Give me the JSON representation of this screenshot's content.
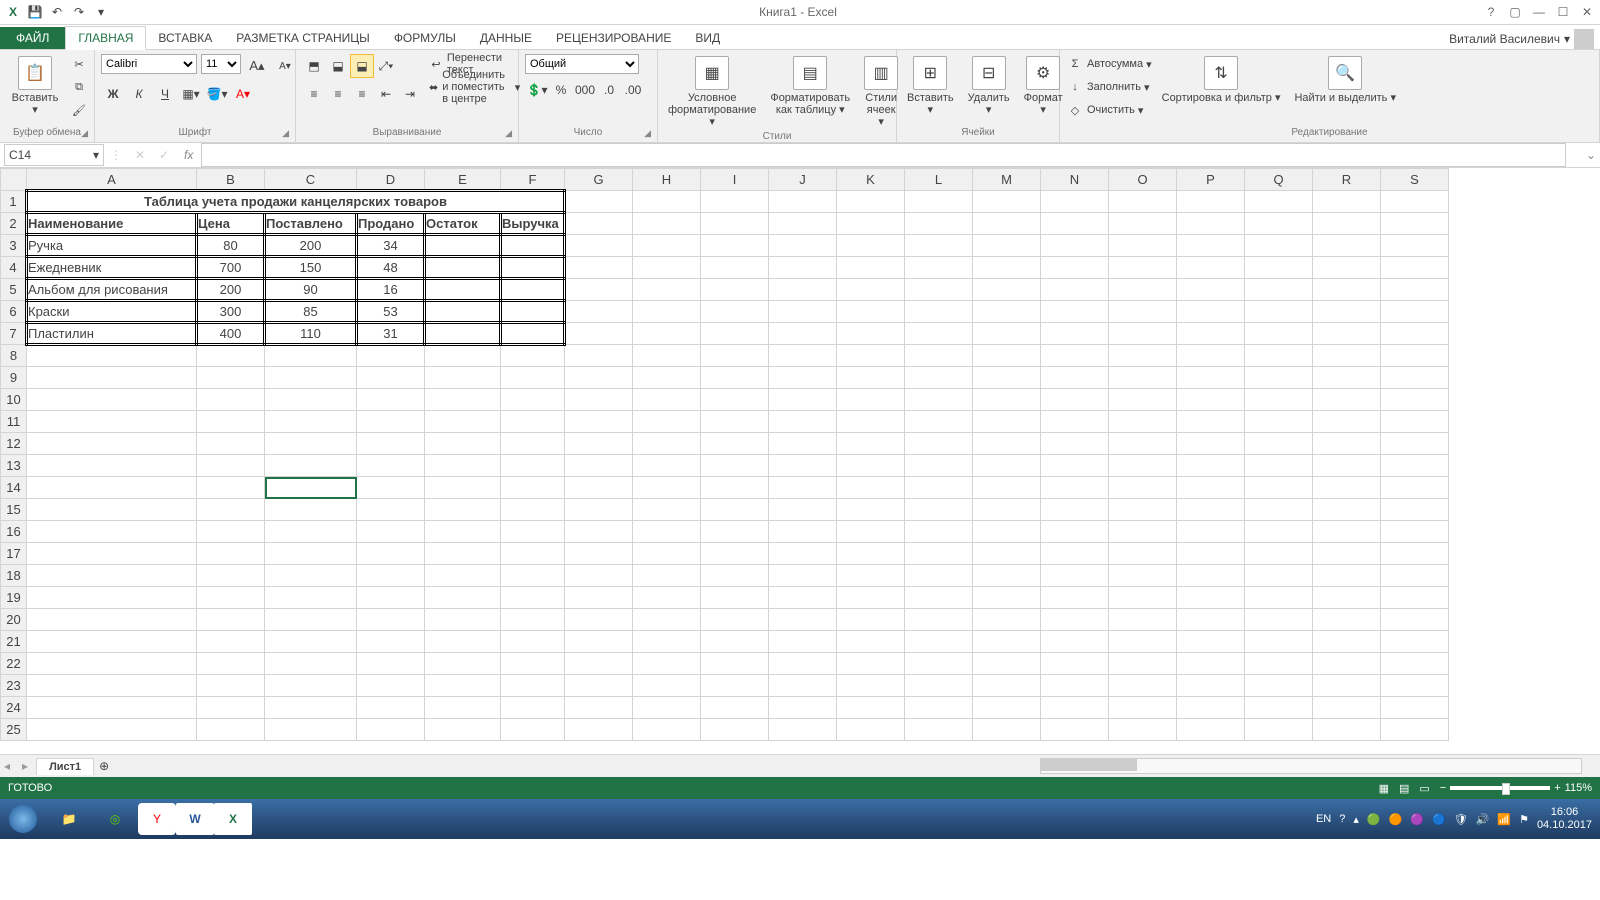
{
  "titlebar": {
    "title": "Книга1 - Excel"
  },
  "qat": {
    "save": "💾",
    "undo": "↶",
    "redo": "↷"
  },
  "account": {
    "name": "Виталий Василевич"
  },
  "tabs": {
    "file": "ФАЙЛ",
    "home": "ГЛАВНАЯ",
    "insert": "ВСТАВКА",
    "pagelayout": "РАЗМЕТКА СТРАНИЦЫ",
    "formulas": "ФОРМУЛЫ",
    "data": "ДАННЫЕ",
    "review": "РЕЦЕНЗИРОВАНИЕ",
    "view": "ВИД"
  },
  "ribbon": {
    "clipboard": {
      "label": "Буфер обмена",
      "paste": "Вставить"
    },
    "font": {
      "label": "Шрифт",
      "name": "Calibri",
      "size": "11",
      "bold": "Ж",
      "italic": "К",
      "underline": "Ч",
      "increase": "A",
      "decrease": "A"
    },
    "alignment": {
      "label": "Выравнивание",
      "wrap": "Перенести текст",
      "merge": "Объединить и поместить в центре"
    },
    "number": {
      "label": "Число",
      "format": "Общий"
    },
    "styles": {
      "label": "Стили",
      "cond": "Условное форматирование",
      "table": "Форматировать как таблицу",
      "cell": "Стили ячеек"
    },
    "cells": {
      "label": "Ячейки",
      "insert": "Вставить",
      "delete": "Удалить",
      "format": "Формат"
    },
    "editing": {
      "label": "Редактирование",
      "autosum": "Автосумма",
      "fill": "Заполнить",
      "clear": "Очистить",
      "sort": "Сортировка и фильтр",
      "find": "Найти и выделить"
    }
  },
  "formulabar": {
    "cellref": "C14",
    "fx": "fx"
  },
  "columns": [
    "A",
    "B",
    "C",
    "D",
    "E",
    "F",
    "G",
    "H",
    "I",
    "J",
    "K",
    "L",
    "M",
    "N",
    "O",
    "P",
    "Q",
    "R",
    "S"
  ],
  "rowcount": 25,
  "selected": {
    "row": 14,
    "col": 3
  },
  "data": {
    "title": "Таблица учета продажи канцелярских товаров",
    "headers": [
      "Наименование",
      "Цена",
      "Поставлено",
      "Продано",
      "Остаток",
      "Выручка"
    ],
    "rows": [
      [
        "Ручка",
        "80",
        "200",
        "34",
        "",
        ""
      ],
      [
        "Ежедневник",
        "700",
        "150",
        "48",
        "",
        ""
      ],
      [
        "Альбом для рисования",
        "200",
        "90",
        "16",
        "",
        ""
      ],
      [
        "Краски",
        "300",
        "85",
        "53",
        "",
        ""
      ],
      [
        "Пластилин",
        "400",
        "110",
        "31",
        "",
        ""
      ]
    ]
  },
  "sheettabs": {
    "sheet1": "Лист1"
  },
  "statusbar": {
    "ready": "ГОТОВО",
    "zoom": "115%"
  },
  "taskbar": {
    "lang": "EN",
    "time": "16:06",
    "date": "04.10.2017"
  }
}
